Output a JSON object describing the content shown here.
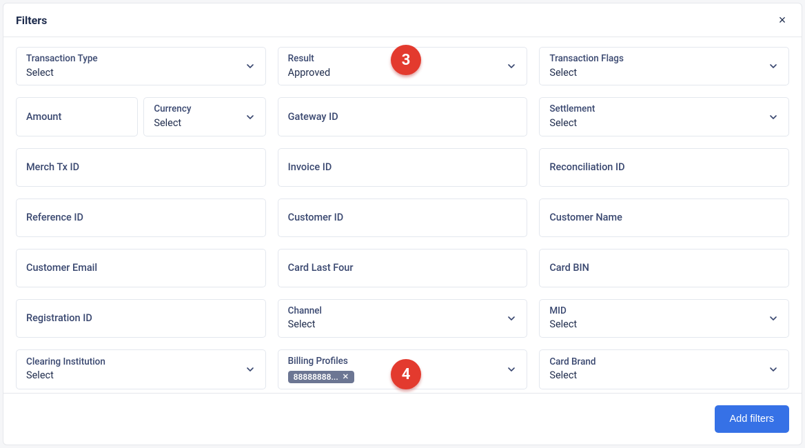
{
  "header": {
    "title": "Filters",
    "close_label": "×"
  },
  "footer": {
    "add_filters_label": "Add filters"
  },
  "common": {
    "select": "Select"
  },
  "fields": {
    "transaction_type": {
      "label": "Transaction Type",
      "value": "Select"
    },
    "result": {
      "label": "Result",
      "value": "Approved"
    },
    "transaction_flags": {
      "label": "Transaction Flags",
      "value": "Select"
    },
    "amount": {
      "label": "Amount"
    },
    "currency": {
      "label": "Currency",
      "value": "Select"
    },
    "gateway_id": {
      "label": "Gateway ID"
    },
    "settlement": {
      "label": "Settlement",
      "value": "Select"
    },
    "merch_tx_id": {
      "label": "Merch Tx ID"
    },
    "invoice_id": {
      "label": "Invoice ID"
    },
    "reconciliation_id": {
      "label": "Reconciliation ID"
    },
    "reference_id": {
      "label": "Reference ID"
    },
    "customer_id": {
      "label": "Customer ID"
    },
    "customer_name": {
      "label": "Customer Name"
    },
    "customer_email": {
      "label": "Customer Email"
    },
    "card_last_four": {
      "label": "Card Last Four"
    },
    "card_bin": {
      "label": "Card BIN"
    },
    "registration_id": {
      "label": "Registration ID"
    },
    "channel": {
      "label": "Channel",
      "value": "Select"
    },
    "mid": {
      "label": "MID",
      "value": "Select"
    },
    "clearing_institution": {
      "label": "Clearing Institution",
      "value": "Select"
    },
    "billing_profiles": {
      "label": "Billing Profiles",
      "chip": "88888888..."
    },
    "card_brand": {
      "label": "Card Brand",
      "value": "Select"
    }
  },
  "callouts": {
    "c3": "3",
    "c4": "4"
  }
}
